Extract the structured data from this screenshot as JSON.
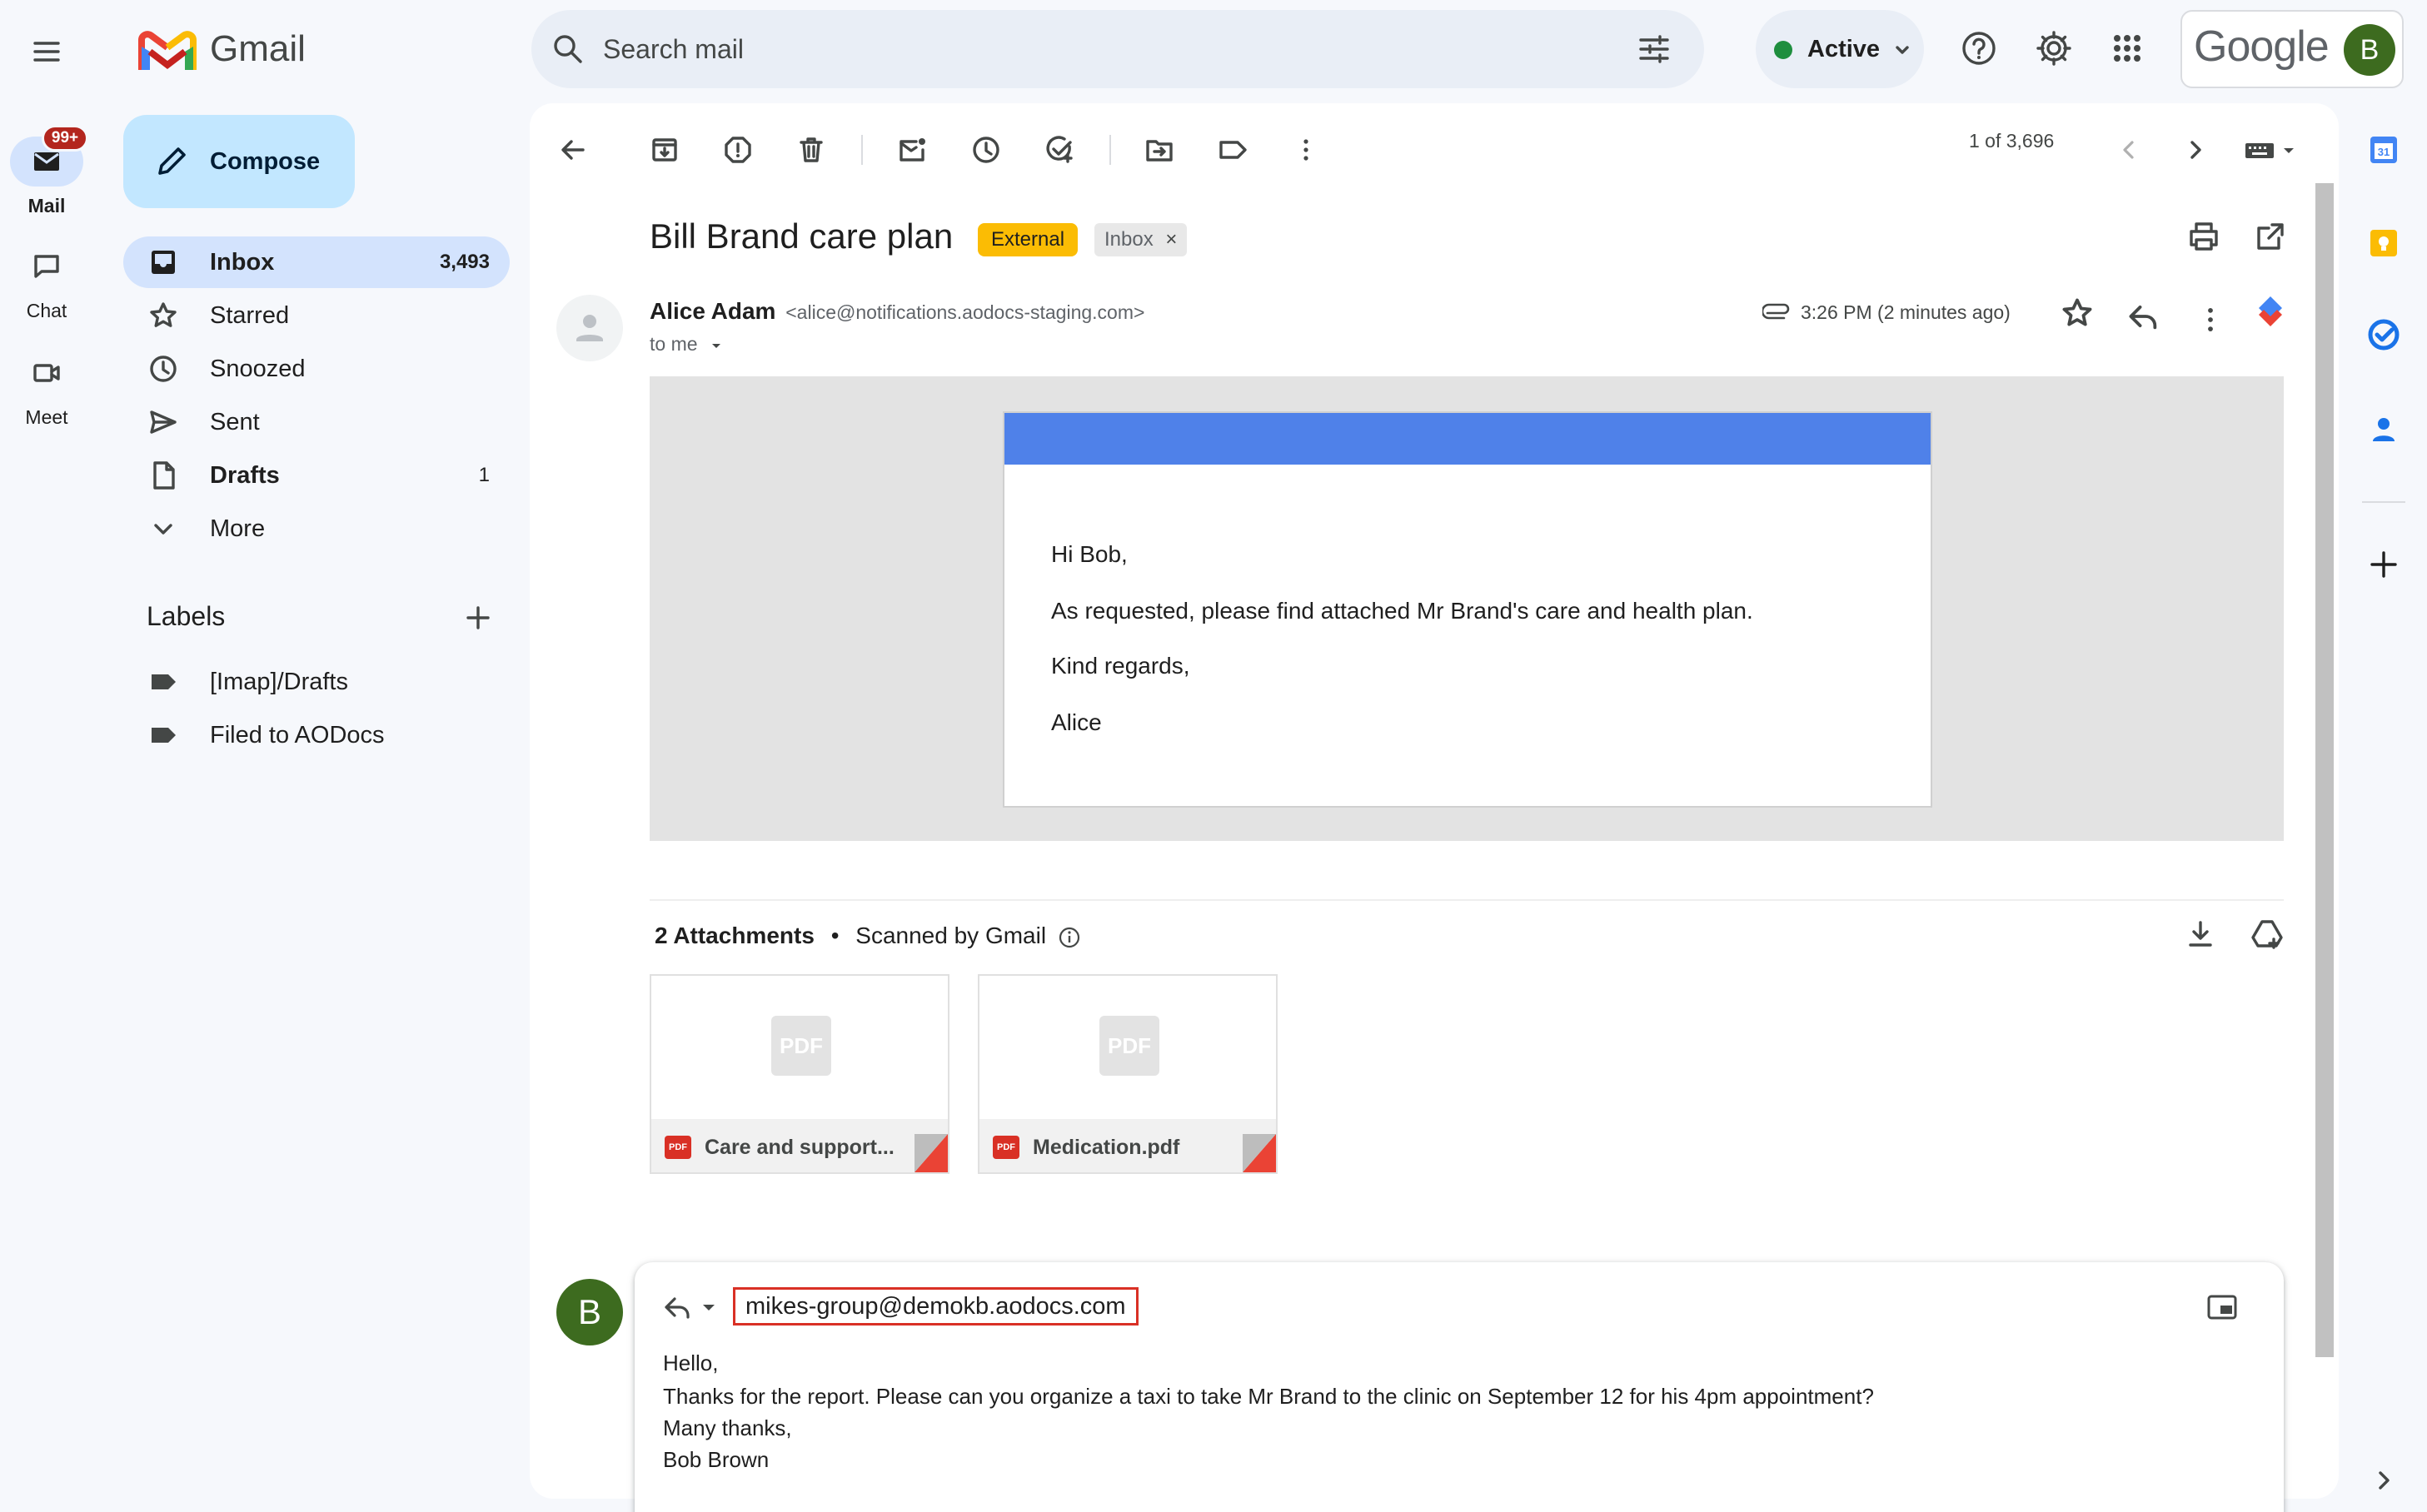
{
  "app": {
    "name": "Gmail"
  },
  "rail": {
    "items": [
      {
        "label": "Mail",
        "badge": "99+"
      },
      {
        "label": "Chat"
      },
      {
        "label": "Meet"
      }
    ]
  },
  "search": {
    "placeholder": "Search mail"
  },
  "status": {
    "label": "Active"
  },
  "account": {
    "brand": "Google",
    "avatar_letter": "B"
  },
  "compose": {
    "label": "Compose"
  },
  "nav": {
    "items": [
      {
        "label": "Inbox",
        "count": "3,493"
      },
      {
        "label": "Starred",
        "count": ""
      },
      {
        "label": "Snoozed",
        "count": ""
      },
      {
        "label": "Sent",
        "count": ""
      },
      {
        "label": "Drafts",
        "count": "1"
      },
      {
        "label": "More",
        "count": ""
      }
    ]
  },
  "labels": {
    "title": "Labels",
    "items": [
      "[Imap]/Drafts",
      "Filed to AODocs"
    ]
  },
  "toolbar": {
    "pager": "1 of 3,696"
  },
  "message": {
    "subject": "Bill Brand care plan",
    "tags": [
      "External",
      "Inbox"
    ],
    "tag_close": "×",
    "sender_name": "Alice Adam",
    "sender_email": "<alice@notifications.aodocs-staging.com>",
    "to": "to me",
    "time": "3:26 PM (2 minutes ago)",
    "body": [
      "Hi Bob,",
      "As requested, please find attached Mr Brand's care and health plan.",
      "Kind regards,",
      "Alice"
    ]
  },
  "attachments": {
    "count_label": "2 Attachments",
    "separator": "•",
    "scan_label": "Scanned by Gmail",
    "pdf_badge": "PDF",
    "files": [
      "Care and support...",
      "Medication.pdf"
    ]
  },
  "reply": {
    "avatar_letter": "B",
    "recipient": "mikes-group@demokb.aodocs.com",
    "lines": [
      "Hello,",
      "Thanks for the report. Please can you organize a taxi to take Mr Brand to the clinic on September 12 for his 4pm appointment?",
      "Many thanks,",
      "Bob Brown"
    ]
  },
  "colors": {
    "accent": "#0b57d0",
    "compose_bg": "#c2e7ff",
    "active_nav": "#d3e3fd",
    "external_tag": "#fbbc04",
    "status_green": "#1e8e3e",
    "mail_header_bar": "#4f81e9",
    "highlight_border": "#d93025"
  },
  "icons": [
    "main-menu-icon",
    "gmail-logo-icon",
    "search-icon",
    "search-options-icon",
    "chevron-down-icon",
    "help-icon",
    "settings-gear-icon",
    "apps-grid-icon",
    "mail-icon",
    "chat-icon",
    "meet-icon",
    "pencil-icon",
    "inbox-icon",
    "star-icon",
    "clock-icon",
    "send-icon",
    "draft-icon",
    "label-icon",
    "plus-icon",
    "back-arrow-icon",
    "archive-icon",
    "report-spam-icon",
    "trash-icon",
    "mark-unread-icon",
    "snooze-icon",
    "add-task-icon",
    "move-to-icon",
    "label-as-icon",
    "more-vert-icon",
    "chevron-left-icon",
    "chevron-right-icon",
    "keyboard-icon",
    "print-icon",
    "open-new-window-icon",
    "person-icon",
    "attachment-clip-icon",
    "reply-icon",
    "aodocs-icon",
    "info-icon",
    "download-icon",
    "save-to-drive-icon",
    "pop-out-icon",
    "calendar-icon",
    "keep-icon",
    "tasks-icon",
    "contacts-icon"
  ]
}
